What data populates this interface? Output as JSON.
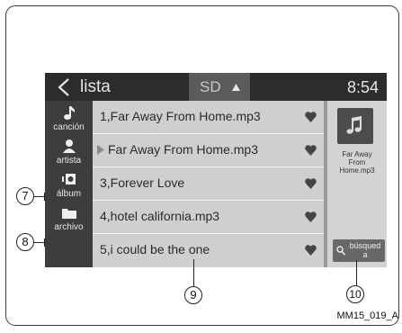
{
  "header": {
    "title": "lista",
    "source": "SD",
    "time": "8:54"
  },
  "sidebar": {
    "items": [
      {
        "label": "canción",
        "icon": "music-note-icon"
      },
      {
        "label": "artista",
        "icon": "person-icon"
      },
      {
        "label": "álbum",
        "icon": "speaker-icon"
      },
      {
        "label": "archivo",
        "icon": "folder-icon"
      }
    ]
  },
  "tracks": [
    {
      "label": "1,Far Away From Home.mp3",
      "playing": false
    },
    {
      "label": "Far Away From Home.mp3",
      "playing": true
    },
    {
      "label": "3,Forever Love",
      "playing": false
    },
    {
      "label": "4,hotel california.mp3",
      "playing": false
    },
    {
      "label": "5,i could be the one",
      "playing": false
    }
  ],
  "now_playing": {
    "title_line1": "Far Away",
    "title_line2": "From",
    "title_line3": "Home.mp3"
  },
  "search": {
    "label_line1": "búsqued",
    "label_line2": "a"
  },
  "callouts": {
    "c7": "7",
    "c8": "8",
    "c9": "9",
    "c10": "10"
  },
  "figure_code": "MM15_019_A",
  "colors": {
    "header": "#2c2c2c",
    "list_bg": "#cfcfcf",
    "sidebar": "#3d3d3d"
  }
}
